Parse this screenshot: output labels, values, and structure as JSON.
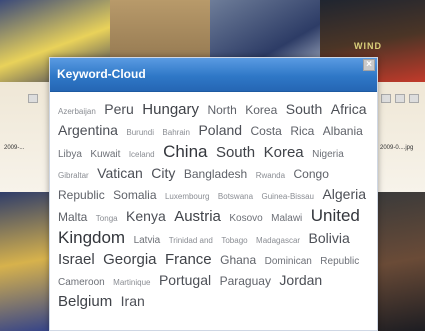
{
  "dialog": {
    "title": "Keyword-Cloud",
    "close_icon": "close-icon",
    "close_glyph": "×"
  },
  "background": {
    "left_filename": "2009-...",
    "right_filename": "2009-0....jpg",
    "banner_text": "WIND"
  },
  "keywords": [
    {
      "text": "Azerbaijan",
      "size": 1
    },
    {
      "text": "Peru",
      "size": 4
    },
    {
      "text": "Hungary",
      "size": 5
    },
    {
      "text": "North",
      "size": 3
    },
    {
      "text": "Korea",
      "size": 3
    },
    {
      "text": "South",
      "size": 4
    },
    {
      "text": "Africa",
      "size": 4
    },
    {
      "text": "Argentina",
      "size": 4
    },
    {
      "text": "Burundi",
      "size": 1
    },
    {
      "text": "Bahrain",
      "size": 1
    },
    {
      "text": "Poland",
      "size": 4
    },
    {
      "text": "Costa",
      "size": 3
    },
    {
      "text": "Rica",
      "size": 3
    },
    {
      "text": "Albania",
      "size": 3
    },
    {
      "text": "Libya",
      "size": 2
    },
    {
      "text": "Kuwait",
      "size": 2
    },
    {
      "text": "Iceland",
      "size": 1
    },
    {
      "text": "China",
      "size": 6
    },
    {
      "text": "South",
      "size": 5
    },
    {
      "text": "Korea",
      "size": 5
    },
    {
      "text": "Nigeria",
      "size": 2
    },
    {
      "text": "Gibraltar",
      "size": 1
    },
    {
      "text": "Vatican",
      "size": 4
    },
    {
      "text": "City",
      "size": 4
    },
    {
      "text": "Bangladesh",
      "size": 3
    },
    {
      "text": "Rwanda",
      "size": 1
    },
    {
      "text": "Congo",
      "size": 3
    },
    {
      "text": "Republic",
      "size": 3
    },
    {
      "text": "Somalia",
      "size": 3
    },
    {
      "text": "Luxembourg",
      "size": 1
    },
    {
      "text": "Botswana",
      "size": 1
    },
    {
      "text": "Guinea-Bissau",
      "size": 1
    },
    {
      "text": "Algeria",
      "size": 4
    },
    {
      "text": "Malta",
      "size": 3
    },
    {
      "text": "Tonga",
      "size": 1
    },
    {
      "text": "Kenya",
      "size": 4
    },
    {
      "text": "Austria",
      "size": 5
    },
    {
      "text": "Kosovo",
      "size": 2
    },
    {
      "text": "Malawi",
      "size": 2
    },
    {
      "text": "United",
      "size": 6
    },
    {
      "text": "Kingdom",
      "size": 6
    },
    {
      "text": "Latvia",
      "size": 2
    },
    {
      "text": "Trinidad and",
      "size": 1
    },
    {
      "text": "Tobago",
      "size": 1
    },
    {
      "text": "Madagascar",
      "size": 1
    },
    {
      "text": "Bolivia",
      "size": 4
    },
    {
      "text": "Israel",
      "size": 5
    },
    {
      "text": "Georgia",
      "size": 5
    },
    {
      "text": "France",
      "size": 5
    },
    {
      "text": "Ghana",
      "size": 3
    },
    {
      "text": "Dominican",
      "size": 2
    },
    {
      "text": "Republic",
      "size": 2
    },
    {
      "text": "Cameroon",
      "size": 2
    },
    {
      "text": "Martinique",
      "size": 1
    },
    {
      "text": "Portugal",
      "size": 4
    },
    {
      "text": "Paraguay",
      "size": 3
    },
    {
      "text": "Jordan",
      "size": 4
    },
    {
      "text": "Belgium",
      "size": 5
    },
    {
      "text": "Iran",
      "size": 4
    }
  ]
}
